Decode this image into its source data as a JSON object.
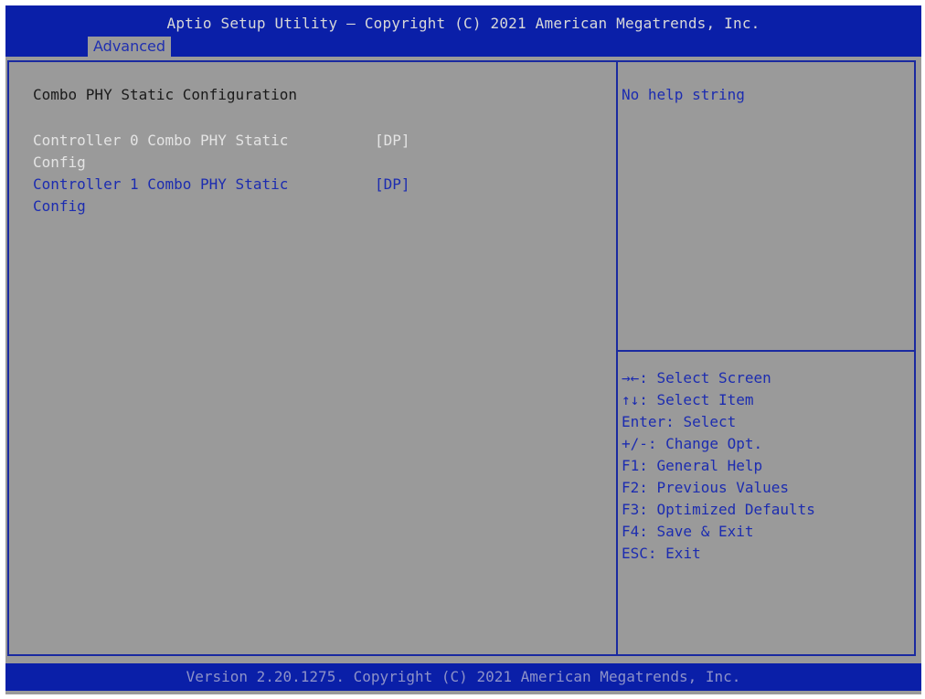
{
  "header": {
    "title": "Aptio Setup Utility – Copyright (C) 2021 American Megatrends, Inc.",
    "active_tab": "Advanced"
  },
  "main": {
    "heading": "Combo PHY Static Configuration",
    "settings": [
      {
        "label": "Controller 0 Combo PHY Static Config",
        "value": "[DP]",
        "selected": true
      },
      {
        "label": "Controller 1 Combo PHY Static Config",
        "value": "[DP]",
        "selected": false
      }
    ]
  },
  "help": {
    "text": "No help string"
  },
  "keys": [
    {
      "key": "→←",
      "action": ": Select Screen",
      "icon": "arrows-left-right-icon"
    },
    {
      "key": "↑↓",
      "action": ": Select Item",
      "icon": "arrows-up-down-icon"
    },
    {
      "key": "Enter",
      "action": ": Select"
    },
    {
      "key": "+/-",
      "action": ": Change Opt."
    },
    {
      "key": "F1",
      "action": ": General Help"
    },
    {
      "key": "F2",
      "action": ": Previous Values"
    },
    {
      "key": "F3",
      "action": ": Optimized Defaults"
    },
    {
      "key": "F4",
      "action": ": Save & Exit"
    },
    {
      "key": "ESC",
      "action": ": Exit"
    }
  ],
  "footer": {
    "version": "Version 2.20.1275. Copyright (C) 2021 American Megatrends, Inc."
  },
  "colors": {
    "background": "#9a9a9a",
    "bar": "#0a1fa8",
    "accent_text": "#1c2cb0",
    "selected_text": "#e4e4e4"
  }
}
